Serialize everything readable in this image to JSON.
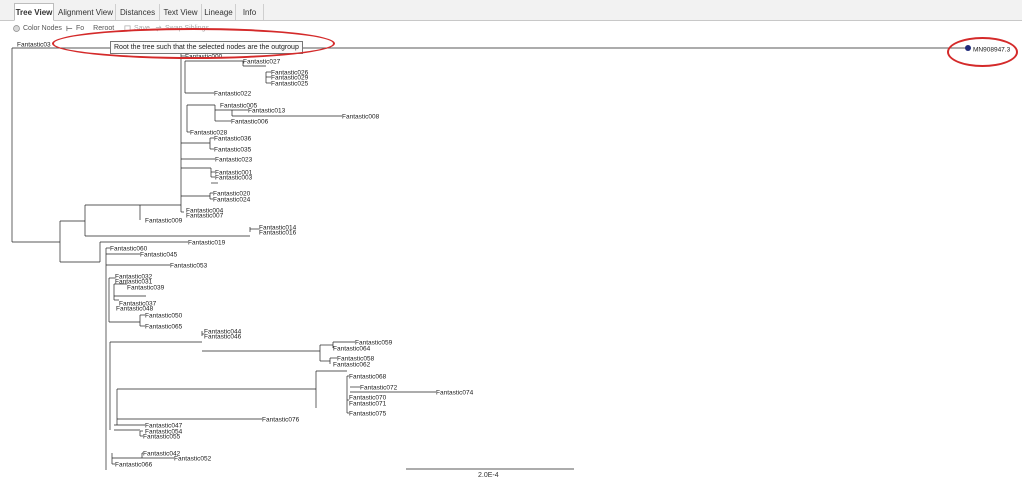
{
  "tabs": [
    {
      "label": "Tree View",
      "active": true
    },
    {
      "label": "Alignment View",
      "active": false
    },
    {
      "label": "Distances",
      "active": false
    },
    {
      "label": "Text View",
      "active": false
    },
    {
      "label": "Lineage",
      "active": false
    },
    {
      "label": "Info",
      "active": false
    }
  ],
  "toolbar": {
    "color_nodes": "Color Nodes",
    "reroot": "Reroot",
    "reroot_partial": "Fo",
    "save": "Save",
    "swap_siblings": "Swap Siblings"
  },
  "tooltip": "Root the tree such that the selected nodes are the outgroup",
  "scale_bar": "2.0E-4",
  "colors": {
    "annotation": "#d42a2a",
    "selected_node": "#1f2a7a",
    "branch": "#222222"
  },
  "tree": {
    "outgroup": "MN908947.3",
    "top_leaf": "Fantastic03",
    "leaves": [
      "Fantastic000",
      "Fantastic027",
      "Fantastic026",
      "Fantastic029",
      "Fantastic025",
      "Fantastic022",
      "Fantastic005",
      "Fantastic013",
      "Fantastic008",
      "Fantastic006",
      "Fantastic028",
      "Fantastic036",
      "Fantastic035",
      "Fantastic023",
      "Fantastic001",
      "Fantastic003",
      "Fantastic020",
      "Fantastic024",
      "Fantastic004",
      "Fantastic007",
      "Fantastic009",
      "Fantastic014",
      "Fantastic016",
      "Fantastic019",
      "Fantastic060",
      "Fantastic045",
      "Fantastic053",
      "Fantastic032",
      "Fantastic031",
      "Fantastic039",
      "Fantastic037",
      "Fantastic048",
      "Fantastic050",
      "Fantastic065",
      "Fantastic044",
      "Fantastic046",
      "Fantastic059",
      "Fantastic064",
      "Fantastic058",
      "Fantastic062",
      "Fantastic068",
      "Fantastic072",
      "Fantastic074",
      "Fantastic070",
      "Fantastic071",
      "Fantastic075",
      "Fantastic076",
      "Fantastic047",
      "Fantastic054",
      "Fantastic055",
      "Fantastic042",
      "Fantastic052",
      "Fantastic066"
    ]
  }
}
